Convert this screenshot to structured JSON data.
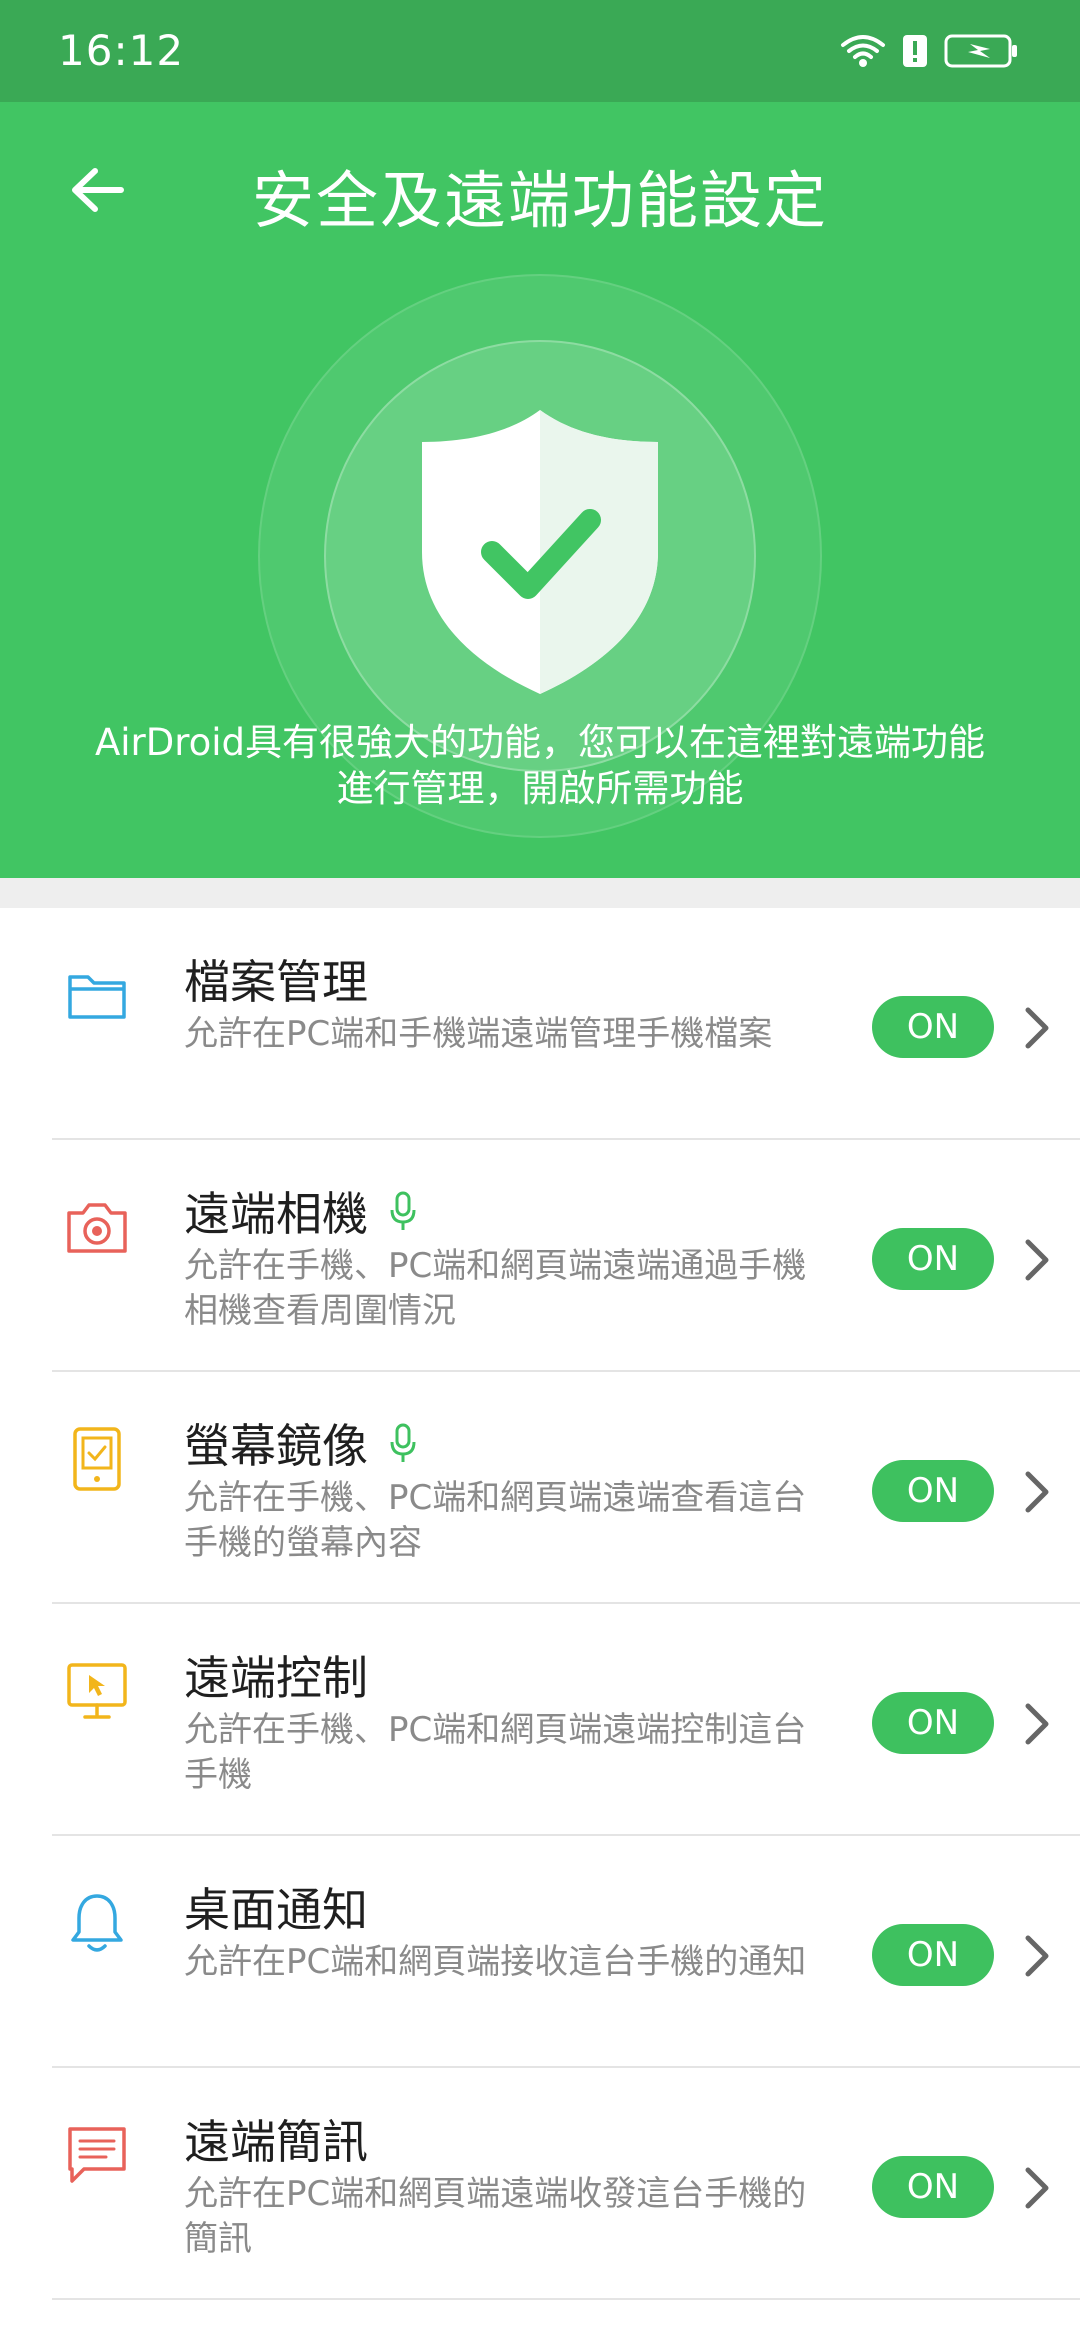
{
  "status_bar": {
    "time": "16:12"
  },
  "header": {
    "title": "安全及遠端功能設定"
  },
  "hero": {
    "description": "AirDroid具有很強大的功能，您可以在這裡對遠端功能進行管理，開啟所需功能"
  },
  "features": [
    {
      "title": "檔案管理",
      "desc": "允許在PC端和手機端遠端管理手機檔案",
      "toggle": "ON",
      "icon": "folder-icon",
      "color": "#34a8e0"
    },
    {
      "title": "遠端相機",
      "desc": "允許在手機、PC端和網頁端遠端通過手機相機查看周圍情況",
      "toggle": "ON",
      "icon": "camera-icon",
      "color": "#e8625a"
    },
    {
      "title": "螢幕鏡像",
      "desc": "允許在手機、PC端和網頁端遠端查看這台手機的螢幕內容",
      "toggle": "ON",
      "icon": "phone-screen-icon",
      "color": "#f2b51b"
    },
    {
      "title": "遠端控制",
      "desc": "允許在手機、PC端和網頁端遠端控制這台手機",
      "toggle": "ON",
      "icon": "monitor-cursor-icon",
      "color": "#f2b51b"
    },
    {
      "title": "桌面通知",
      "desc": "允許在PC端和網頁端接收這台手機的通知",
      "toggle": "ON",
      "icon": "bell-icon",
      "color": "#34a8e0"
    },
    {
      "title": "遠端簡訊",
      "desc": "允許在PC端和網頁端遠端收發這台手機的簡訊",
      "toggle": "ON",
      "icon": "message-icon",
      "color": "#e8625a"
    }
  ],
  "colors": {
    "header_green": "#41c563",
    "status_green": "#3aa955",
    "toggle_green": "#3ec15f",
    "mic_green": "#3ec15f"
  }
}
